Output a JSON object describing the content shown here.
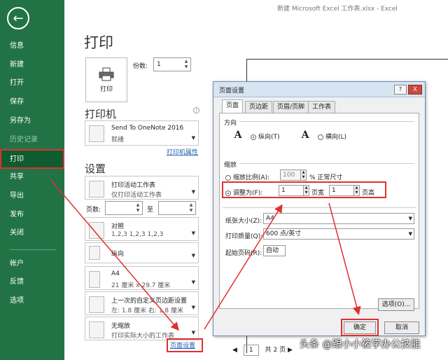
{
  "window": {
    "title": "新建 Microsoft Excel 工作表.xlsx  -  Excel"
  },
  "sidebar": {
    "back_icon": "back-arrow-icon",
    "items": [
      {
        "label": "信息"
      },
      {
        "label": "新建"
      },
      {
        "label": "打开"
      },
      {
        "label": "保存"
      },
      {
        "label": "另存为"
      },
      {
        "label": "历史记录"
      },
      {
        "label": "打印"
      },
      {
        "label": "共享"
      },
      {
        "label": "导出"
      },
      {
        "label": "发布"
      },
      {
        "label": "关闭"
      },
      {
        "label": "帐户"
      },
      {
        "label": "反馈"
      },
      {
        "label": "选项"
      }
    ]
  },
  "print": {
    "heading": "打印",
    "print_button": "打印",
    "copies_label": "份数:",
    "copies_value": "1",
    "printer_section": "打印机",
    "printer_name": "Send To OneNote 2016",
    "printer_status": "就绪",
    "printer_properties": "打印机属性",
    "settings_section": "设置",
    "scope_line1": "打印活动工作表",
    "scope_line2": "仅打印活动工作表",
    "pages_label": "页数:",
    "to_label": "至",
    "collate_line1": "对照",
    "collate_line2": "1,2,3    1,2,3    1,2,3",
    "orientation": "纵向",
    "paper_line1": "A4",
    "paper_line2": "21 厘米 x 29.7 厘米",
    "margin_line1": "上一次的自定义页边距设置",
    "margin_line2": "左: 1.8 厘米    右: 1.8 厘米",
    "scaling_line1": "无缩放",
    "scaling_line2": "打印实际大小的工作表",
    "page_setup_link": "页面设置",
    "pager_value": "1",
    "pager_total": "共 2 页"
  },
  "dialog": {
    "title": "页面设置",
    "help": "?",
    "close": "X",
    "tabs": [
      "页面",
      "页边距",
      "页眉/页脚",
      "工作表"
    ],
    "orientation_group": "方向",
    "portrait": "纵向(T)",
    "landscape": "横向(L)",
    "scaling_group": "缩放",
    "adjust_pct": "缩放比例(A):",
    "pct_value": "100",
    "pct_suffix": "% 正常尺寸",
    "fit_to": "调整为(F):",
    "fit_wide_value": "1",
    "fit_wide_label": "页宽",
    "fit_tall_value": "1",
    "fit_tall_label": "页高",
    "paper_size_label": "纸张大小(Z):",
    "paper_size_value": "A4",
    "print_quality_label": "打印质量(Q):",
    "print_quality_value": "600 点/英寸",
    "first_page_label": "起始页码(R):",
    "first_page_value": "自动",
    "options_button": "选项(O)...",
    "ok_button": "确定",
    "cancel_button": "取消"
  },
  "watermark": "头条 @跟小小筱学办公技能",
  "colors": {
    "sidebar": "#217346",
    "sidebar_active": "#0e5c2f",
    "highlight": "#e03030"
  }
}
